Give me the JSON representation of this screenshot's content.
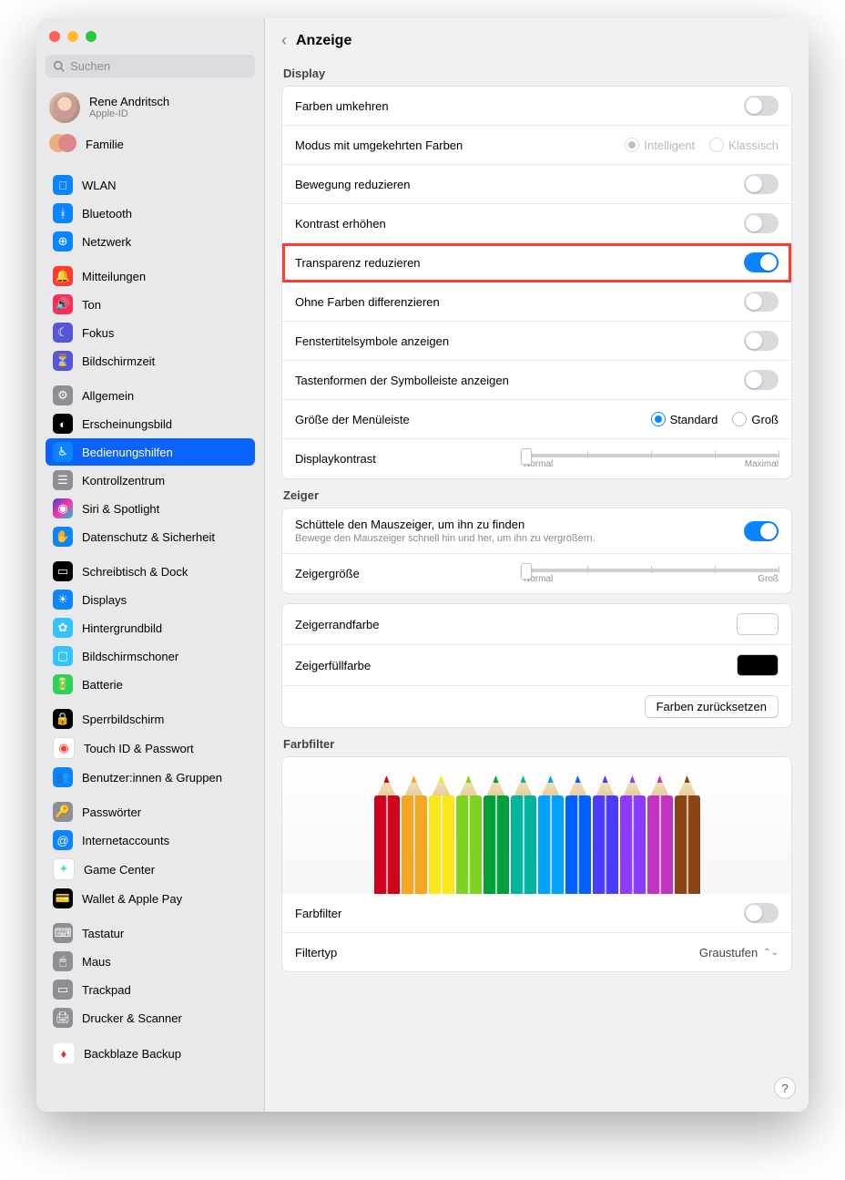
{
  "search": {
    "placeholder": "Suchen"
  },
  "account": {
    "name": "Rene Andritsch",
    "subtitle": "Apple-ID"
  },
  "family_label": "Familie",
  "nav": {
    "wlan": "WLAN",
    "bluetooth": "Bluetooth",
    "network": "Netzwerk",
    "notifications": "Mitteilungen",
    "sound": "Ton",
    "focus": "Fokus",
    "screentime": "Bildschirmzeit",
    "general": "Allgemein",
    "appearance": "Erscheinungsbild",
    "accessibility": "Bedienungshilfen",
    "controlcenter": "Kontrollzentrum",
    "siri": "Siri & Spotlight",
    "privacy": "Datenschutz & Sicherheit",
    "desktop": "Schreibtisch & Dock",
    "displays": "Displays",
    "wallpaper": "Hintergrundbild",
    "screensaver": "Bildschirmschoner",
    "battery": "Batterie",
    "lock": "Sperrbildschirm",
    "touchid": "Touch ID & Passwort",
    "users": "Benutzer:innen & Gruppen",
    "passwords": "Passwörter",
    "internetaccounts": "Internetaccounts",
    "gamecenter": "Game Center",
    "wallet": "Wallet & Apple Pay",
    "keyboard": "Tastatur",
    "mouse": "Maus",
    "trackpad": "Trackpad",
    "printers": "Drucker & Scanner",
    "backblaze": "Backblaze Backup"
  },
  "header": {
    "title": "Anzeige"
  },
  "sections": {
    "display": "Display",
    "pointer": "Zeiger",
    "colorfilter": "Farbfilter"
  },
  "display": {
    "invert_colors": "Farben umkehren",
    "invert_mode_label": "Modus mit umgekehrten Farben",
    "invert_mode_smart": "Intelligent",
    "invert_mode_classic": "Klassisch",
    "reduce_motion": "Bewegung reduzieren",
    "increase_contrast": "Kontrast erhöhen",
    "reduce_transparency": "Transparenz reduzieren",
    "differentiate_without_color": "Ohne Farben differenzieren",
    "show_window_title_icons": "Fenstertitelsymbole anzeigen",
    "show_toolbar_button_shapes": "Tastenformen der Symbolleiste anzeigen",
    "menubar_size_label": "Größe der Menüleiste",
    "menubar_size_standard": "Standard",
    "menubar_size_large": "Groß",
    "display_contrast_label": "Displaykontrast",
    "slider_normal": "Normal",
    "slider_max": "Maximal"
  },
  "pointer": {
    "shake_title": "Schüttele den Mauszeiger, um ihn zu finden",
    "shake_sub": "Bewege den Mauszeiger schnell hin und her, um ihn zu vergrößern.",
    "size_label": "Zeigergröße",
    "size_normal": "Normal",
    "size_large": "Groß",
    "outline_label": "Zeigerrandfarbe",
    "fill_label": "Zeigerfüllfarbe",
    "reset_colors": "Farben zurücksetzen"
  },
  "colorfilter": {
    "enable_label": "Farbfilter",
    "type_label": "Filtertyp",
    "type_value": "Graustufen"
  },
  "pencil_colors": [
    "#d0021b",
    "#f5a623",
    "#f8e71c",
    "#7ed321",
    "#009f3c",
    "#00b4a0",
    "#00a2ff",
    "#0061ff",
    "#4a3bff",
    "#8b3bff",
    "#c233c2",
    "#8b4513"
  ]
}
